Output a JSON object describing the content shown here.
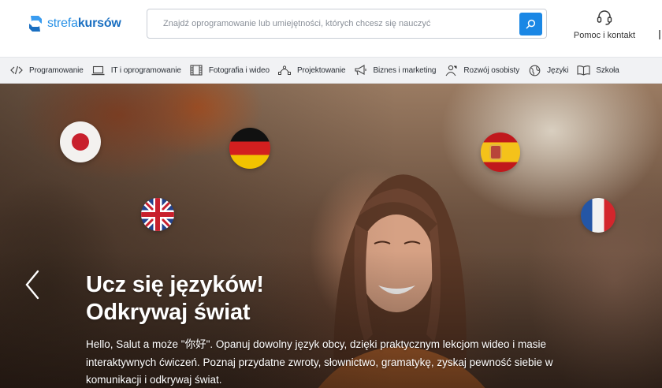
{
  "header": {
    "logo": {
      "text_prefix": "strefa",
      "text_bold": "kursów",
      "icon": "strefakursow-logo-icon",
      "color": "#1d7fd6"
    },
    "search": {
      "placeholder": "Znajdź oprogramowanie lub umiejętności, których chcesz się nauczyć",
      "value": "",
      "button_icon": "search-icon",
      "button_color": "#1a87e5"
    },
    "help": {
      "label": "Pomoc i kontakt",
      "icon": "headset-icon"
    }
  },
  "categories": [
    {
      "label": "Programowanie",
      "icon": "code-icon"
    },
    {
      "label": "IT i oprogramowanie",
      "icon": "laptop-icon"
    },
    {
      "label": "Fotografia i wideo",
      "icon": "film-icon"
    },
    {
      "label": "Projektowanie",
      "icon": "vector-path-icon"
    },
    {
      "label": "Biznes i marketing",
      "icon": "megaphone-icon"
    },
    {
      "label": "Rozwój osobisty",
      "icon": "person-growth-icon"
    },
    {
      "label": "Języki",
      "icon": "globe-icon"
    },
    {
      "label": "Szkoła",
      "icon": "book-icon"
    }
  ],
  "hero": {
    "title_line1": "Ucz się języków!",
    "title_line2": "Odkrywaj świat",
    "description": "Hello, Salut a może \"你好\". Opanuj dowolny język obcy, dzięki praktycznym lekcjom wideo i masie interaktywnych ćwiczeń. Poznaj przydatne zwroty, słownictwo, gramatykę, zyskaj pewność siebie w komunikacji i odkrywaj świat.",
    "prev_icon": "chevron-left-icon",
    "flags": [
      "japan-flag-icon",
      "germany-flag-icon",
      "spain-flag-icon",
      "uk-flag-icon",
      "france-flag-icon"
    ]
  }
}
